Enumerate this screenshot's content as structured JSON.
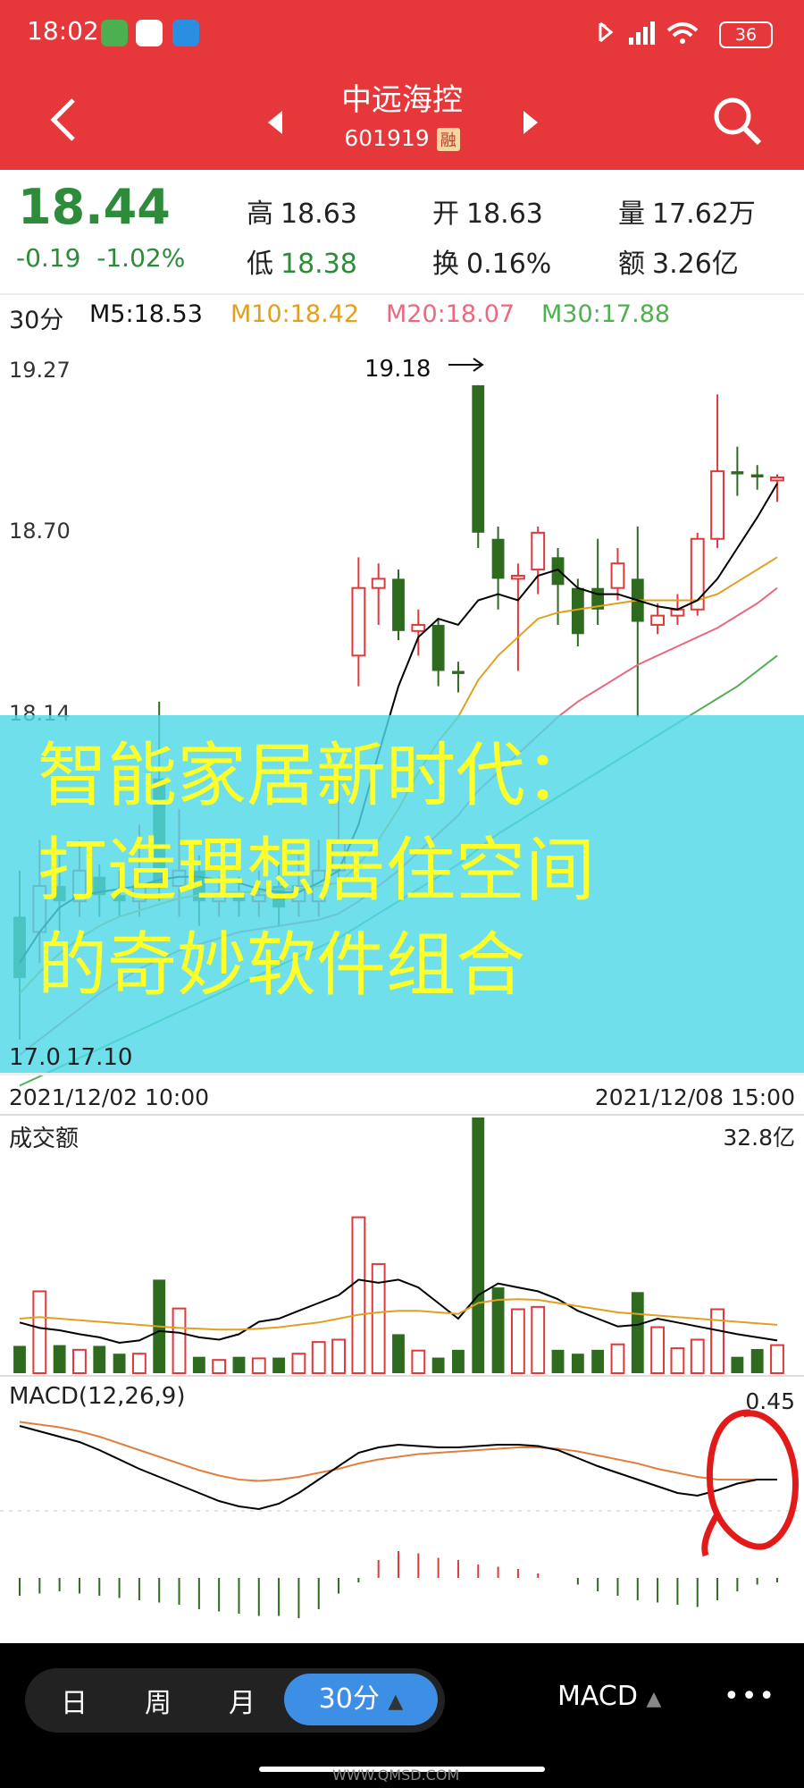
{
  "status_bar": {
    "time": "18:02",
    "battery": "36"
  },
  "header": {
    "title": "中远海控",
    "code": "601919",
    "badge": "融"
  },
  "quote": {
    "price": "18.44",
    "change": "-0.19",
    "change_pct": "-1.02%",
    "high_label": "高",
    "high": "18.63",
    "low_label": "低",
    "low": "18.38",
    "open_label": "开",
    "open": "18.63",
    "turnover_label": "换",
    "turnover": "0.16%",
    "volume_label": "量",
    "volume": "17.62万",
    "amount_label": "额",
    "amount": "3.26亿"
  },
  "ma_bar": {
    "period": "30分",
    "m5": "M5:18.53",
    "m10": "M10:18.42",
    "m20": "M20:18.07",
    "m30": "M30:17.88"
  },
  "price_chart": {
    "y_top": "19.27",
    "y_mid": "18.70",
    "y_low": "18.14",
    "y_bottom": "17.0",
    "high_label": "19.18",
    "low_label": "17.10",
    "start_time": "2021/12/02 10:00",
    "end_time": "2021/12/08 15:00"
  },
  "volume_chart": {
    "title": "成交额",
    "max": "32.8亿"
  },
  "macd": {
    "title": "MACD(12,26,9)",
    "max": "0.45"
  },
  "banner": {
    "line1": "智能家居新时代：",
    "line2": "打造理想居住空间",
    "line3": "的奇妙软件组合"
  },
  "bottom_tabs": {
    "day": "日",
    "week": "周",
    "month": "月",
    "active": "30分",
    "indicator": "MACD",
    "more": "•••"
  },
  "footer_watermark": "WWW.QMSD.COM",
  "colors": {
    "header": "#e6383b",
    "up": "#e0393b",
    "down": "#2e6b1f",
    "ma5": "#000000",
    "ma10": "#e0a020",
    "ma20": "#e86a80",
    "ma30": "#50b050",
    "banner_bg": "#4fd8e8",
    "banner_text": "#ffff2a"
  },
  "chart_data": {
    "type": "candlestick",
    "title": "",
    "ylim": [
      17.0,
      19.27
    ],
    "candles": [
      {
        "o": 17.45,
        "c": 17.25,
        "h": 17.6,
        "l": 17.05,
        "up": false
      },
      {
        "o": 17.4,
        "c": 17.55,
        "h": 17.7,
        "l": 17.3,
        "up": true
      },
      {
        "o": 17.55,
        "c": 17.5,
        "h": 17.65,
        "l": 17.4,
        "up": false
      },
      {
        "o": 17.5,
        "c": 17.6,
        "h": 17.7,
        "l": 17.45,
        "up": true
      },
      {
        "o": 17.58,
        "c": 17.52,
        "h": 17.62,
        "l": 17.45,
        "up": false
      },
      {
        "o": 17.52,
        "c": 17.5,
        "h": 17.6,
        "l": 17.45,
        "up": false
      },
      {
        "o": 17.5,
        "c": 17.55,
        "h": 17.75,
        "l": 17.45,
        "up": true
      },
      {
        "o": 17.9,
        "c": 17.55,
        "h": 18.15,
        "l": 17.5,
        "up": false
      },
      {
        "o": 17.55,
        "c": 17.6,
        "h": 17.8,
        "l": 17.45,
        "up": true
      },
      {
        "o": 17.6,
        "c": 17.5,
        "h": 17.65,
        "l": 17.42,
        "up": false
      },
      {
        "o": 17.5,
        "c": 17.52,
        "h": 17.58,
        "l": 17.45,
        "up": true
      },
      {
        "o": 17.52,
        "c": 17.5,
        "h": 17.58,
        "l": 17.45,
        "up": false
      },
      {
        "o": 17.5,
        "c": 17.52,
        "h": 17.6,
        "l": 17.45,
        "up": true
      },
      {
        "o": 17.55,
        "c": 17.48,
        "h": 17.62,
        "l": 17.42,
        "up": false
      },
      {
        "o": 17.5,
        "c": 17.55,
        "h": 17.65,
        "l": 17.45,
        "up": true
      },
      {
        "o": 17.5,
        "c": 17.6,
        "h": 17.7,
        "l": 17.45,
        "up": true
      },
      {
        "o": 17.6,
        "c": 17.7,
        "h": 17.9,
        "l": 17.55,
        "up": true
      },
      {
        "o": 18.3,
        "c": 18.52,
        "h": 18.62,
        "l": 18.2,
        "up": true
      },
      {
        "o": 18.52,
        "c": 18.55,
        "h": 18.6,
        "l": 18.4,
        "up": true
      },
      {
        "o": 18.55,
        "c": 18.38,
        "h": 18.58,
        "l": 18.35,
        "up": false
      },
      {
        "o": 18.38,
        "c": 18.4,
        "h": 18.45,
        "l": 18.3,
        "up": true
      },
      {
        "o": 18.4,
        "c": 18.25,
        "h": 18.42,
        "l": 18.2,
        "up": false
      },
      {
        "o": 18.25,
        "c": 18.24,
        "h": 18.28,
        "l": 18.18,
        "up": false
      },
      {
        "o": 19.18,
        "c": 18.7,
        "h": 19.18,
        "l": 18.65,
        "up": false
      },
      {
        "o": 18.68,
        "c": 18.55,
        "h": 18.72,
        "l": 18.45,
        "up": false
      },
      {
        "o": 18.55,
        "c": 18.56,
        "h": 18.6,
        "l": 18.25,
        "up": true
      },
      {
        "o": 18.58,
        "c": 18.7,
        "h": 18.72,
        "l": 18.5,
        "up": true
      },
      {
        "o": 18.62,
        "c": 18.53,
        "h": 18.65,
        "l": 18.4,
        "up": false
      },
      {
        "o": 18.52,
        "c": 18.37,
        "h": 18.55,
        "l": 18.33,
        "up": false
      },
      {
        "o": 18.52,
        "c": 18.45,
        "h": 18.68,
        "l": 18.4,
        "up": false
      },
      {
        "o": 18.52,
        "c": 18.6,
        "h": 18.65,
        "l": 18.48,
        "up": true
      },
      {
        "o": 18.55,
        "c": 18.41,
        "h": 18.72,
        "l": 18.1,
        "up": false
      },
      {
        "o": 18.4,
        "c": 18.43,
        "h": 18.47,
        "l": 18.37,
        "up": true
      },
      {
        "o": 18.43,
        "c": 18.45,
        "h": 18.5,
        "l": 18.4,
        "up": true
      },
      {
        "o": 18.45,
        "c": 18.68,
        "h": 18.7,
        "l": 18.43,
        "up": true
      },
      {
        "o": 18.68,
        "c": 18.9,
        "h": 19.15,
        "l": 18.65,
        "up": true
      },
      {
        "o": 18.9,
        "c": 18.89,
        "h": 18.98,
        "l": 18.82,
        "up": false
      },
      {
        "o": 18.89,
        "c": 18.88,
        "h": 18.92,
        "l": 18.84,
        "up": false
      },
      {
        "o": 18.88,
        "c": 18.87,
        "h": 18.89,
        "l": 18.8,
        "up": true
      }
    ],
    "ma5": [
      17.3,
      17.4,
      17.48,
      17.52,
      17.53,
      17.54,
      17.55,
      17.57,
      17.58,
      17.58,
      17.57,
      17.56,
      17.54,
      17.53,
      17.53,
      17.56,
      17.6,
      17.75,
      17.98,
      18.2,
      18.36,
      18.42,
      18.4,
      18.48,
      18.5,
      18.48,
      18.56,
      18.58,
      18.52,
      18.5,
      18.5,
      18.48,
      18.46,
      18.45,
      18.48,
      18.55,
      18.65,
      18.75,
      18.86
    ],
    "ma10": [
      17.2,
      17.27,
      17.33,
      17.38,
      17.42,
      17.45,
      17.47,
      17.49,
      17.51,
      17.52,
      17.53,
      17.53,
      17.53,
      17.54,
      17.54,
      17.55,
      17.56,
      17.62,
      17.7,
      17.8,
      17.92,
      18.02,
      18.1,
      18.22,
      18.3,
      18.36,
      18.42,
      18.44,
      18.45,
      18.46,
      18.47,
      18.48,
      18.48,
      18.48,
      18.48,
      18.5,
      18.54,
      18.58,
      18.62
    ],
    "ma20": [
      17.0,
      17.05,
      17.1,
      17.15,
      17.2,
      17.24,
      17.28,
      17.31,
      17.34,
      17.36,
      17.38,
      17.4,
      17.41,
      17.42,
      17.43,
      17.44,
      17.46,
      17.5,
      17.55,
      17.6,
      17.66,
      17.72,
      17.78,
      17.86,
      17.92,
      17.98,
      18.04,
      18.1,
      18.15,
      18.19,
      18.23,
      18.27,
      18.3,
      18.33,
      18.36,
      18.39,
      18.43,
      18.47,
      18.52
    ],
    "ma30": [
      16.9,
      16.93,
      16.96,
      16.99,
      17.02,
      17.05,
      17.08,
      17.11,
      17.14,
      17.17,
      17.2,
      17.23,
      17.26,
      17.29,
      17.32,
      17.35,
      17.38,
      17.42,
      17.46,
      17.5,
      17.54,
      17.58,
      17.62,
      17.67,
      17.72,
      17.76,
      17.8,
      17.84,
      17.88,
      17.92,
      17.96,
      18.0,
      18.04,
      18.08,
      18.12,
      18.16,
      18.2,
      18.25,
      18.3
    ],
    "amount": [
      3.5,
      10.5,
      3.6,
      3.0,
      3.5,
      2.5,
      2.5,
      12.0,
      8.3,
      2.1,
      1.7,
      2.1,
      1.9,
      2.0,
      2.5,
      4.0,
      4.3,
      20.0,
      14.0,
      5.0,
      2.9,
      2.0,
      3.0,
      32.8,
      11.0,
      8.2,
      8.5,
      3.0,
      2.5,
      3.0,
      3.7,
      10.4,
      5.9,
      3.2,
      4.3,
      8.2,
      2.1,
      3.1,
      3.6
    ],
    "amount_ma_a": [
      6.5,
      5.8,
      5.5,
      5.0,
      4.6,
      3.9,
      4.2,
      5.4,
      5.2,
      4.6,
      4.3,
      5.0,
      6.6,
      7.0,
      8.0,
      9.0,
      10.0,
      12.0,
      11.6,
      12.0,
      11.0,
      9.0,
      7.0,
      10.0,
      11.5,
      11.0,
      10.5,
      9.5,
      8.0,
      7.0,
      6.0,
      6.2,
      7.0,
      6.5,
      6.0,
      5.5,
      5.0,
      4.6,
      4.2
    ],
    "amount_ma_b": [
      7.0,
      7.2,
      7.0,
      6.8,
      6.6,
      6.4,
      6.2,
      6.0,
      5.8,
      5.7,
      5.6,
      5.6,
      5.7,
      5.9,
      6.2,
      6.5,
      7.0,
      7.5,
      7.8,
      8.0,
      8.0,
      7.8,
      7.6,
      9.0,
      9.4,
      9.5,
      9.4,
      9.0,
      8.6,
      8.2,
      7.8,
      7.6,
      7.4,
      7.2,
      7.0,
      6.8,
      6.6,
      6.4,
      6.2
    ],
    "macd_hist": [
      -0.08,
      -0.07,
      -0.06,
      -0.07,
      -0.08,
      -0.09,
      -0.1,
      -0.11,
      -0.12,
      -0.14,
      -0.15,
      -0.16,
      -0.17,
      -0.17,
      -0.18,
      -0.14,
      -0.07,
      -0.02,
      0.08,
      0.12,
      0.11,
      0.09,
      0.08,
      0.06,
      0.05,
      0.04,
      0.02,
      0.0,
      -0.03,
      -0.06,
      -0.08,
      -0.1,
      -0.11,
      -0.12,
      -0.13,
      -0.1,
      -0.06,
      -0.03,
      -0.02
    ],
    "dif": [
      0.3,
      0.26,
      0.22,
      0.18,
      0.12,
      0.05,
      -0.02,
      -0.08,
      -0.14,
      -0.2,
      -0.26,
      -0.3,
      -0.32,
      -0.28,
      -0.2,
      -0.1,
      0.0,
      0.1,
      0.14,
      0.16,
      0.15,
      0.14,
      0.14,
      0.15,
      0.16,
      0.16,
      0.15,
      0.12,
      0.06,
      0.0,
      -0.05,
      -0.1,
      -0.15,
      -0.2,
      -0.22,
      -0.18,
      -0.13,
      -0.1,
      -0.1
    ],
    "dea": [
      0.33,
      0.31,
      0.29,
      0.26,
      0.22,
      0.17,
      0.12,
      0.07,
      0.02,
      -0.03,
      -0.07,
      -0.1,
      -0.11,
      -0.1,
      -0.08,
      -0.05,
      -0.02,
      0.02,
      0.05,
      0.07,
      0.09,
      0.1,
      0.11,
      0.12,
      0.13,
      0.14,
      0.14,
      0.13,
      0.11,
      0.08,
      0.05,
      0.02,
      -0.02,
      -0.05,
      -0.08,
      -0.1,
      -0.1,
      -0.1,
      -0.1
    ]
  }
}
